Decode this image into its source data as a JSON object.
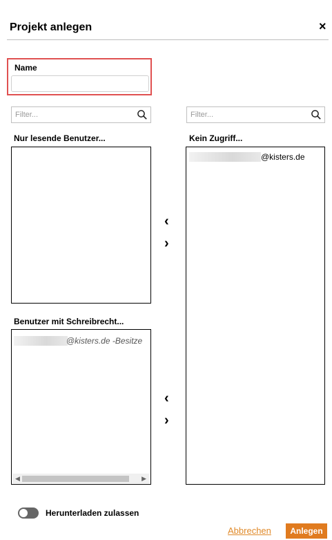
{
  "dialog": {
    "title": "Projekt anlegen",
    "close_glyph": "×"
  },
  "name_field": {
    "label": "Name",
    "value": "",
    "placeholder": ""
  },
  "left_filter": {
    "placeholder": "Filter..."
  },
  "right_filter": {
    "placeholder": "Filter..."
  },
  "read_only_list": {
    "label": "Nur lesende Benutzer...",
    "items": []
  },
  "no_access_list": {
    "label": "Kein Zugriff...",
    "items": [
      {
        "suffix": "@kisters.de"
      }
    ]
  },
  "write_list": {
    "label": "Benutzer mit Schreibrecht...",
    "items": [
      {
        "suffix": "@kisters.de -Besitze"
      }
    ]
  },
  "arrows": {
    "move_left": "‹",
    "move_right": "›"
  },
  "download_toggle": {
    "label": "Herunterladen zulassen",
    "enabled": false
  },
  "footer": {
    "cancel_label": "Abbrechen",
    "create_label": "Anlegen"
  },
  "colors": {
    "accent": "#e07b1f",
    "highlight_border": "#e05050"
  },
  "icons": [
    "search-icon",
    "close-icon",
    "chevron-left-icon",
    "chevron-right-icon"
  ]
}
